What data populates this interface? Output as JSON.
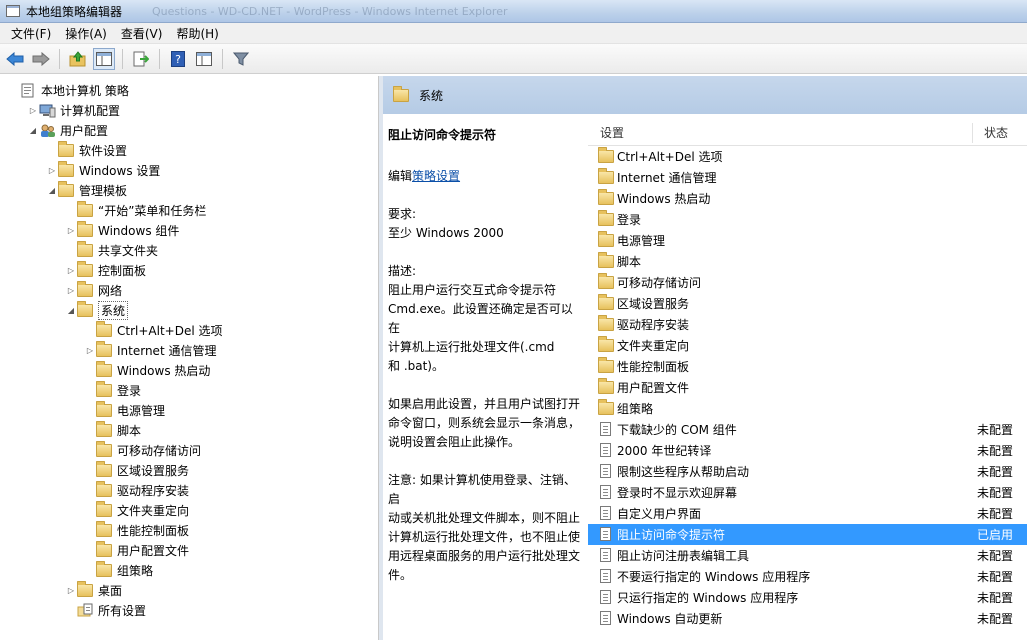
{
  "window": {
    "title": "本地组策略编辑器",
    "faded_caption": "Questions - WD-CD.NET - WordPress - Windows Internet Explorer"
  },
  "menu": [
    "文件(F)",
    "操作(A)",
    "查看(V)",
    "帮助(H)"
  ],
  "toolbar_icons": [
    "back-arrow-icon",
    "forward-arrow-icon",
    "up-folder-icon",
    "show-hide-tree-icon",
    "export-list-icon",
    "help-icon",
    "properties-icon",
    "filter-icon"
  ],
  "tree": [
    {
      "label": "本地计算机 策略",
      "depth": 0,
      "arrow": "",
      "icon": "computer-policy-icon"
    },
    {
      "label": "计算机配置",
      "depth": 1,
      "arrow": "collapsed",
      "icon": "computer-icon"
    },
    {
      "label": "用户配置",
      "depth": 1,
      "arrow": "expanded",
      "icon": "users-icon"
    },
    {
      "label": "软件设置",
      "depth": 2,
      "arrow": "",
      "icon": "folder-icon"
    },
    {
      "label": "Windows 设置",
      "depth": 2,
      "arrow": "collapsed",
      "icon": "folder-icon"
    },
    {
      "label": "管理模板",
      "depth": 2,
      "arrow": "expanded",
      "icon": "folder-icon"
    },
    {
      "label": "“开始”菜单和任务栏",
      "depth": 3,
      "arrow": "",
      "icon": "folder-icon"
    },
    {
      "label": "Windows 组件",
      "depth": 3,
      "arrow": "collapsed",
      "icon": "folder-icon"
    },
    {
      "label": "共享文件夹",
      "depth": 3,
      "arrow": "",
      "icon": "folder-icon"
    },
    {
      "label": "控制面板",
      "depth": 3,
      "arrow": "collapsed",
      "icon": "folder-icon"
    },
    {
      "label": "网络",
      "depth": 3,
      "arrow": "collapsed",
      "icon": "folder-icon"
    },
    {
      "label": "系统",
      "depth": 3,
      "arrow": "expanded",
      "icon": "folder-icon",
      "boxed": true
    },
    {
      "label": "Ctrl+Alt+Del 选项",
      "depth": 4,
      "arrow": "",
      "icon": "folder-icon"
    },
    {
      "label": "Internet 通信管理",
      "depth": 4,
      "arrow": "collapsed",
      "icon": "folder-icon"
    },
    {
      "label": "Windows 热启动",
      "depth": 4,
      "arrow": "",
      "icon": "folder-icon"
    },
    {
      "label": "登录",
      "depth": 4,
      "arrow": "",
      "icon": "folder-icon"
    },
    {
      "label": "电源管理",
      "depth": 4,
      "arrow": "",
      "icon": "folder-icon"
    },
    {
      "label": "脚本",
      "depth": 4,
      "arrow": "",
      "icon": "folder-icon"
    },
    {
      "label": "可移动存储访问",
      "depth": 4,
      "arrow": "",
      "icon": "folder-icon"
    },
    {
      "label": "区域设置服务",
      "depth": 4,
      "arrow": "",
      "icon": "folder-icon"
    },
    {
      "label": "驱动程序安装",
      "depth": 4,
      "arrow": "",
      "icon": "folder-icon"
    },
    {
      "label": "文件夹重定向",
      "depth": 4,
      "arrow": "",
      "icon": "folder-icon"
    },
    {
      "label": "性能控制面板",
      "depth": 4,
      "arrow": "",
      "icon": "folder-icon"
    },
    {
      "label": "用户配置文件",
      "depth": 4,
      "arrow": "",
      "icon": "folder-icon"
    },
    {
      "label": "组策略",
      "depth": 4,
      "arrow": "",
      "icon": "folder-icon"
    },
    {
      "label": "桌面",
      "depth": 3,
      "arrow": "collapsed",
      "icon": "folder-icon"
    },
    {
      "label": "所有设置",
      "depth": 3,
      "arrow": "",
      "icon": "all-settings-icon"
    }
  ],
  "right_header": {
    "title": "系统"
  },
  "description": {
    "title": "阻止访问命令提示符",
    "edit_prefix": "编辑",
    "edit_link": "策略设置",
    "req_label": "要求:",
    "req_value": "至少 Windows 2000",
    "desc_label": "描述:",
    "desc_lines": [
      "阻止用户运行交互式命令提示符",
      "Cmd.exe。此设置还确定是否可以在",
      "计算机上运行批处理文件(.cmd",
      "和 .bat)。"
    ],
    "enabled_lines": [
      "如果启用此设置，并且用户试图打开",
      "命令窗口，则系统会显示一条消息，",
      "说明设置会阻止此操作。"
    ],
    "note_lines": [
      "注意: 如果计算机使用登录、注销、启",
      "动或关机批处理文件脚本，则不阻止",
      "计算机运行批处理文件，也不阻止使",
      "用远程桌面服务的用户运行批处理文",
      "件。"
    ]
  },
  "list": {
    "col_setting": "设置",
    "col_status": "状态",
    "rows": [
      {
        "label": "Ctrl+Alt+Del 选项",
        "status": "",
        "type": "folder"
      },
      {
        "label": "Internet 通信管理",
        "status": "",
        "type": "folder"
      },
      {
        "label": "Windows 热启动",
        "status": "",
        "type": "folder"
      },
      {
        "label": "登录",
        "status": "",
        "type": "folder"
      },
      {
        "label": "电源管理",
        "status": "",
        "type": "folder"
      },
      {
        "label": "脚本",
        "status": "",
        "type": "folder"
      },
      {
        "label": "可移动存储访问",
        "status": "",
        "type": "folder"
      },
      {
        "label": "区域设置服务",
        "status": "",
        "type": "folder"
      },
      {
        "label": "驱动程序安装",
        "status": "",
        "type": "folder"
      },
      {
        "label": "文件夹重定向",
        "status": "",
        "type": "folder"
      },
      {
        "label": "性能控制面板",
        "status": "",
        "type": "folder"
      },
      {
        "label": "用户配置文件",
        "status": "",
        "type": "folder"
      },
      {
        "label": "组策略",
        "status": "",
        "type": "folder"
      },
      {
        "label": "下载缺少的 COM 组件",
        "status": "未配置",
        "type": "setting"
      },
      {
        "label": "2000 年世纪转译",
        "status": "未配置",
        "type": "setting"
      },
      {
        "label": "限制这些程序从帮助启动",
        "status": "未配置",
        "type": "setting"
      },
      {
        "label": "登录时不显示欢迎屏幕",
        "status": "未配置",
        "type": "setting"
      },
      {
        "label": "自定义用户界面",
        "status": "未配置",
        "type": "setting"
      },
      {
        "label": "阻止访问命令提示符",
        "status": "已启用",
        "type": "setting",
        "selected": true
      },
      {
        "label": "阻止访问注册表编辑工具",
        "status": "未配置",
        "type": "setting"
      },
      {
        "label": "不要运行指定的 Windows 应用程序",
        "status": "未配置",
        "type": "setting"
      },
      {
        "label": "只运行指定的 Windows 应用程序",
        "status": "未配置",
        "type": "setting"
      },
      {
        "label": "Windows 自动更新",
        "status": "未配置",
        "type": "setting"
      }
    ]
  },
  "colors": {
    "selection": "#3399ff",
    "header_blue": "#bdd1ea",
    "link": "#0b4fa8"
  }
}
